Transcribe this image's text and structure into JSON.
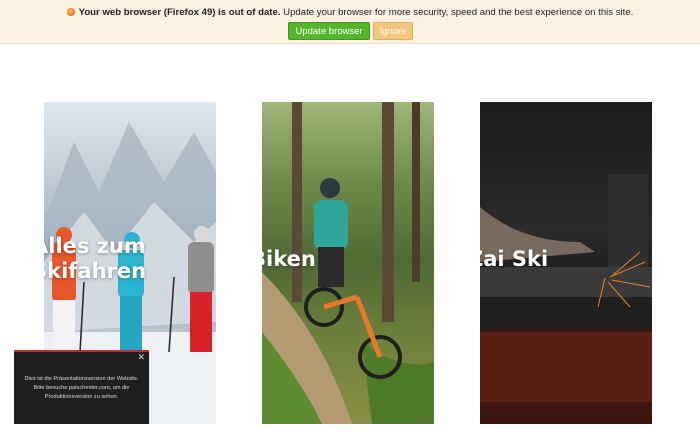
{
  "update_banner": {
    "message_bold": "Your web browser (Firefox 49) is out of date.",
    "message_rest": "Update your browser for more security, speed and the best experience on this site.",
    "update_label": "Update browser",
    "ignore_label": "Ignore"
  },
  "cards": [
    {
      "label_line1": "Alles zum",
      "label_line2": "Skifahren"
    },
    {
      "label": "Biken"
    },
    {
      "label": "Zai Ski"
    }
  ],
  "notice": {
    "close_symbol": "✕",
    "text": "Dies ist die Präsentationsversion der Website. Bitte besuche patscheider.com, um die Produktionsversion zu sehen."
  }
}
